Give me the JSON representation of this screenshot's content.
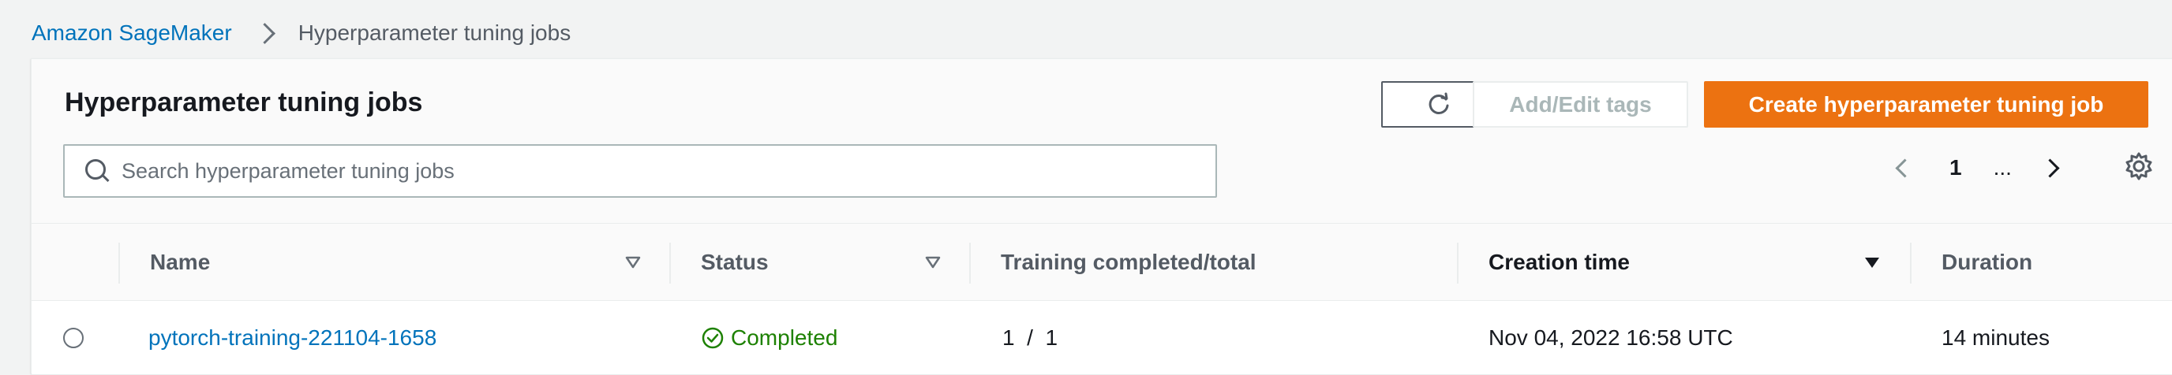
{
  "breadcrumb": {
    "root": "Amazon SageMaker",
    "current": "Hyperparameter tuning jobs"
  },
  "panel": {
    "title": "Hyperparameter tuning jobs",
    "buttons": {
      "refresh_icon": "refresh-icon",
      "tags_label": "Add/Edit tags",
      "create_label": "Create hyperparameter tuning job"
    },
    "search": {
      "placeholder": "Search hyperparameter tuning jobs",
      "value": ""
    },
    "pagination": {
      "current_page": "1",
      "ellipsis": "..."
    }
  },
  "table": {
    "columns": [
      {
        "label": "Name",
        "sort": "sortable"
      },
      {
        "label": "Status",
        "sort": "sortable"
      },
      {
        "label": "Training completed/total",
        "sort": "none"
      },
      {
        "label": "Creation time",
        "sort": "descending"
      },
      {
        "label": "Duration",
        "sort": "none"
      }
    ],
    "rows": [
      {
        "name": "pytorch-training-221104-1658",
        "status": "Completed",
        "training_completed_total": "1  /  1",
        "creation_time": "Nov 04, 2022 16:58 UTC",
        "duration": "14 minutes"
      }
    ]
  },
  "colors": {
    "accent": "#ec7211",
    "link": "#0073bb",
    "success": "#1d8102"
  }
}
